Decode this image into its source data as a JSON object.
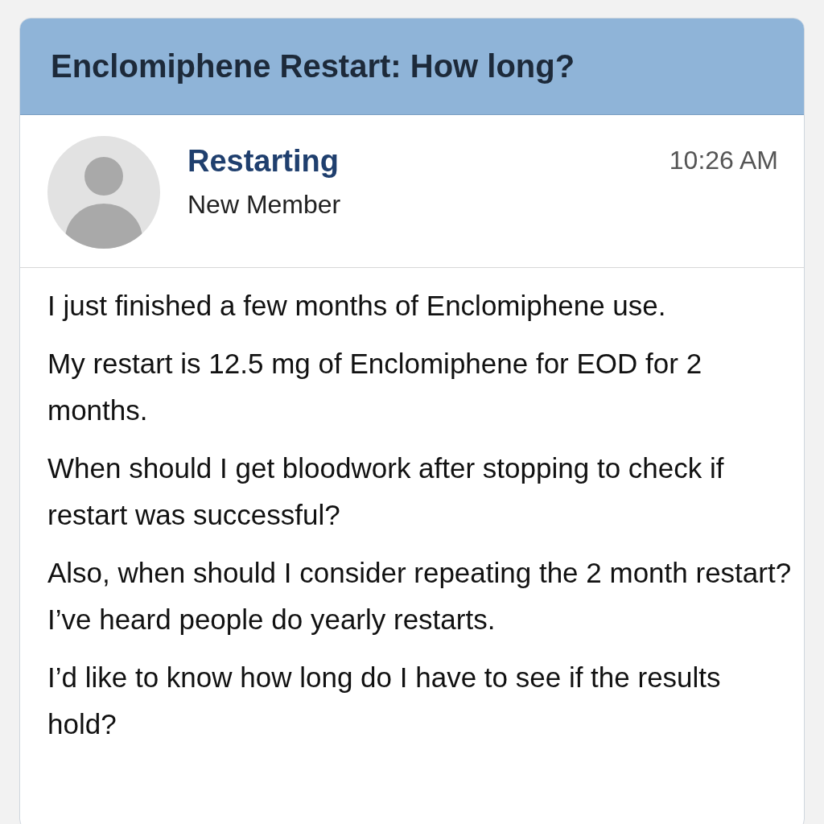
{
  "thread": {
    "title": "Enclomiphene Restart: How long?"
  },
  "post": {
    "author": "Restarting",
    "rank": "New Member",
    "time": "10:26 AM",
    "paragraphs": [
      "I just finished a few months of Enclomiphene use.",
      "My restart is 12.5 mg of Enclomiphene for EOD for 2 months.",
      "When should I get bloodwork after stopping to check if restart was successful?",
      "Also, when should I consider repeating the 2 month restart? I’ve heard people do yearly restarts.",
      "I’d like to know how long do I have to see if the results hold?"
    ]
  }
}
